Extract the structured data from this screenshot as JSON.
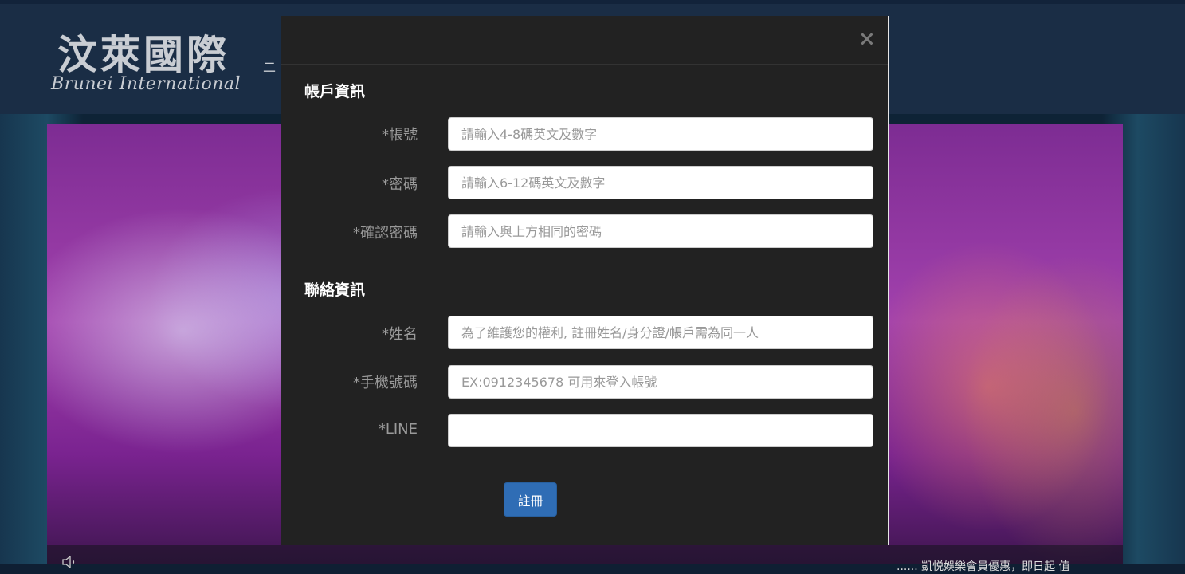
{
  "site": {
    "logo_cn": "汶萊國際",
    "logo_en": "Brunei International",
    "header_link": "二",
    "marquee": "...... 凱悦娛樂會員優惠，即日起 值"
  },
  "modal": {
    "close_label": "×",
    "account_section": {
      "title": "帳戶資訊",
      "fields": [
        {
          "label": "*帳號",
          "placeholder": "請輸入4-8碼英文及數字",
          "value": ""
        },
        {
          "label": "*密碼",
          "placeholder": "請輸入6-12碼英文及數字",
          "value": ""
        },
        {
          "label": "*確認密碼",
          "placeholder": "請輸入與上方相同的密碼",
          "value": ""
        }
      ]
    },
    "contact_section": {
      "title": "聯絡資訊",
      "fields": [
        {
          "label": "*姓名",
          "placeholder": "為了維護您的權利, 註冊姓名/身分證/帳戶需為同一人",
          "value": ""
        },
        {
          "label": "*手機號碼",
          "placeholder": "EX:0912345678 可用來登入帳號",
          "value": ""
        },
        {
          "label": "*LINE",
          "placeholder": "",
          "value": ""
        }
      ]
    },
    "submit_label": "註冊"
  },
  "colors": {
    "modal_bg": "#222222",
    "header_bg": "#1a2d45",
    "button_primary": "#2f6db5",
    "hero_purple": "#a241ad"
  },
  "icons": {
    "close": "close-icon",
    "volume": "volume-icon"
  }
}
